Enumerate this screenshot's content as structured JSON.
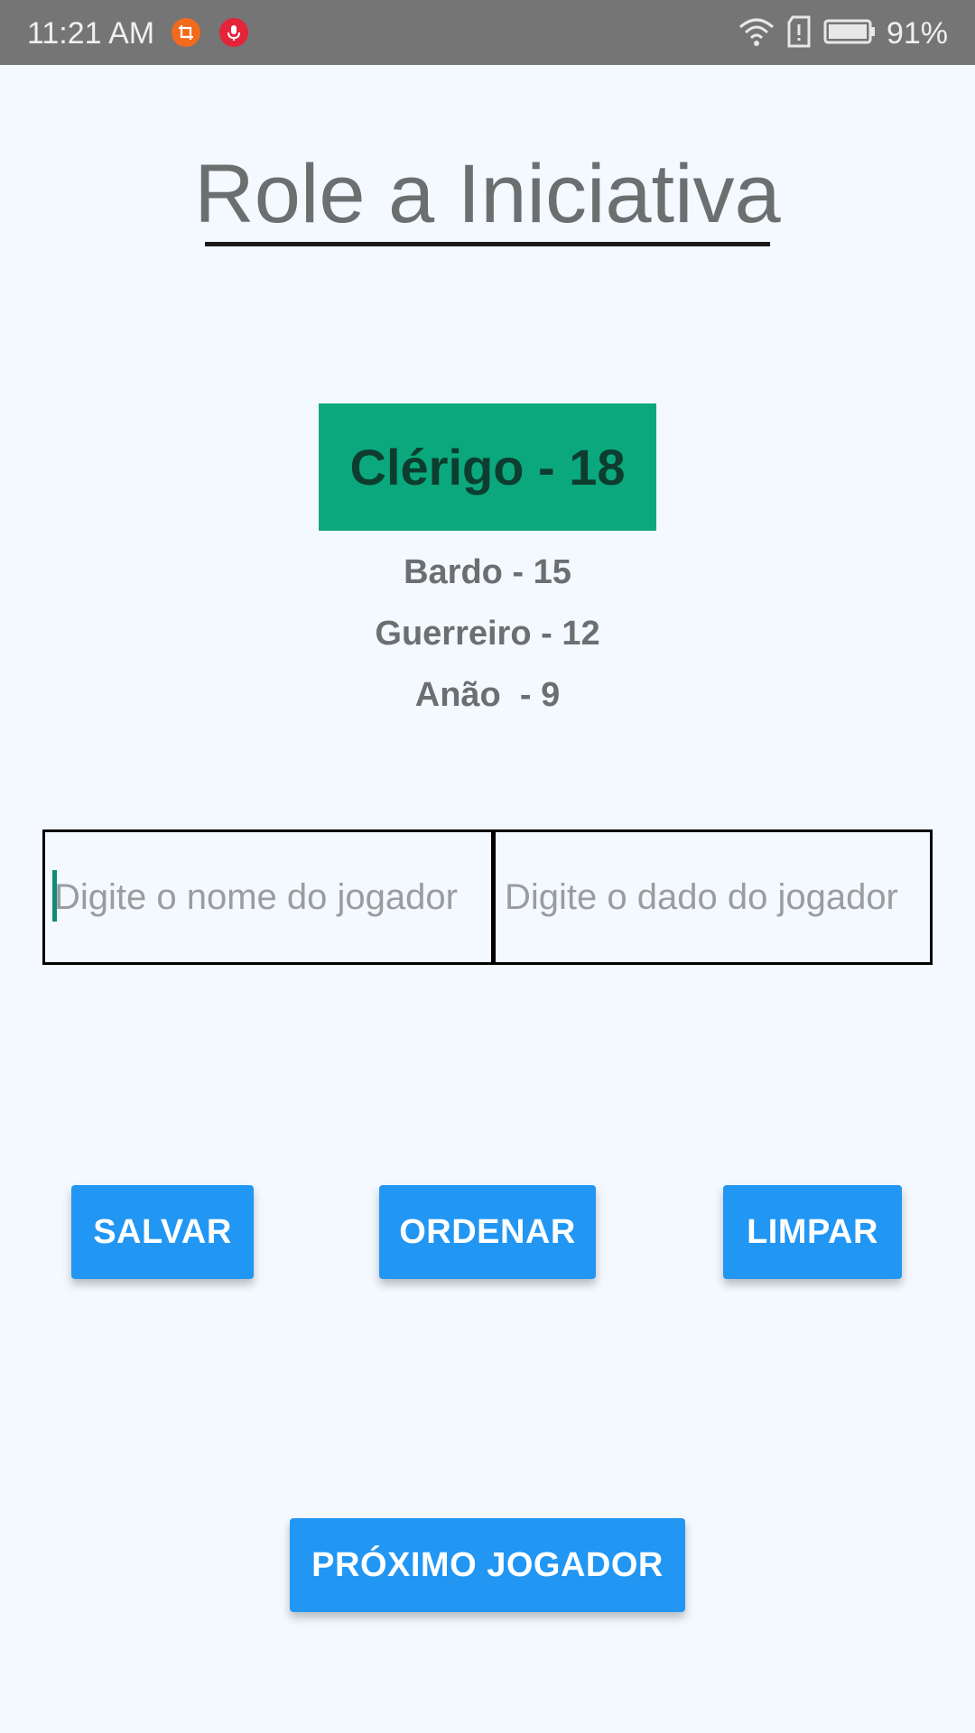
{
  "status_bar": {
    "time": "11:21 AM",
    "battery_percent": "91%",
    "icons": [
      "crop-icon",
      "mic-icon",
      "wifi-icon",
      "sim-alert-icon",
      "battery-icon"
    ]
  },
  "title": "Role a Iniciativa",
  "current_player": "Clérigo - 18",
  "queue": [
    "Bardo - 15",
    "Guerreiro - 12",
    "Anão  - 9"
  ],
  "inputs": {
    "name_placeholder": "Digite o nome do jogador",
    "name_value": "",
    "dice_placeholder": "Digite o dado do jogador",
    "dice_value": ""
  },
  "buttons": {
    "save": "SALVAR",
    "sort": "ORDENAR",
    "clear": "LIMPAR",
    "next_player": "PRÓXIMO JOGADOR"
  },
  "colors": {
    "background": "#f3f9ff",
    "status_bar": "#757575",
    "current_player_bg": "#0ba87d",
    "current_player_text": "#0d3d2e",
    "button": "#2196f3",
    "text_gray": "#6c6f70"
  }
}
